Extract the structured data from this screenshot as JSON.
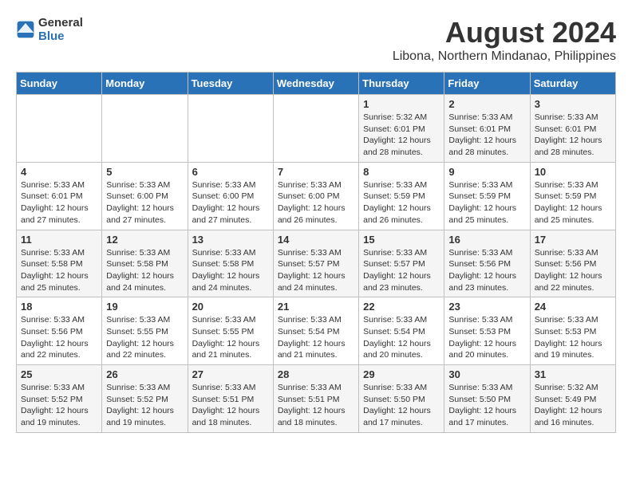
{
  "logo": {
    "line1": "General",
    "line2": "Blue"
  },
  "title": "August 2024",
  "location": "Libona, Northern Mindanao, Philippines",
  "days_of_week": [
    "Sunday",
    "Monday",
    "Tuesday",
    "Wednesday",
    "Thursday",
    "Friday",
    "Saturday"
  ],
  "weeks": [
    [
      {
        "day": "",
        "info": ""
      },
      {
        "day": "",
        "info": ""
      },
      {
        "day": "",
        "info": ""
      },
      {
        "day": "",
        "info": ""
      },
      {
        "day": "1",
        "info": "Sunrise: 5:32 AM\nSunset: 6:01 PM\nDaylight: 12 hours\nand 28 minutes."
      },
      {
        "day": "2",
        "info": "Sunrise: 5:33 AM\nSunset: 6:01 PM\nDaylight: 12 hours\nand 28 minutes."
      },
      {
        "day": "3",
        "info": "Sunrise: 5:33 AM\nSunset: 6:01 PM\nDaylight: 12 hours\nand 28 minutes."
      }
    ],
    [
      {
        "day": "4",
        "info": "Sunrise: 5:33 AM\nSunset: 6:01 PM\nDaylight: 12 hours\nand 27 minutes."
      },
      {
        "day": "5",
        "info": "Sunrise: 5:33 AM\nSunset: 6:00 PM\nDaylight: 12 hours\nand 27 minutes."
      },
      {
        "day": "6",
        "info": "Sunrise: 5:33 AM\nSunset: 6:00 PM\nDaylight: 12 hours\nand 27 minutes."
      },
      {
        "day": "7",
        "info": "Sunrise: 5:33 AM\nSunset: 6:00 PM\nDaylight: 12 hours\nand 26 minutes."
      },
      {
        "day": "8",
        "info": "Sunrise: 5:33 AM\nSunset: 5:59 PM\nDaylight: 12 hours\nand 26 minutes."
      },
      {
        "day": "9",
        "info": "Sunrise: 5:33 AM\nSunset: 5:59 PM\nDaylight: 12 hours\nand 25 minutes."
      },
      {
        "day": "10",
        "info": "Sunrise: 5:33 AM\nSunset: 5:59 PM\nDaylight: 12 hours\nand 25 minutes."
      }
    ],
    [
      {
        "day": "11",
        "info": "Sunrise: 5:33 AM\nSunset: 5:58 PM\nDaylight: 12 hours\nand 25 minutes."
      },
      {
        "day": "12",
        "info": "Sunrise: 5:33 AM\nSunset: 5:58 PM\nDaylight: 12 hours\nand 24 minutes."
      },
      {
        "day": "13",
        "info": "Sunrise: 5:33 AM\nSunset: 5:58 PM\nDaylight: 12 hours\nand 24 minutes."
      },
      {
        "day": "14",
        "info": "Sunrise: 5:33 AM\nSunset: 5:57 PM\nDaylight: 12 hours\nand 24 minutes."
      },
      {
        "day": "15",
        "info": "Sunrise: 5:33 AM\nSunset: 5:57 PM\nDaylight: 12 hours\nand 23 minutes."
      },
      {
        "day": "16",
        "info": "Sunrise: 5:33 AM\nSunset: 5:56 PM\nDaylight: 12 hours\nand 23 minutes."
      },
      {
        "day": "17",
        "info": "Sunrise: 5:33 AM\nSunset: 5:56 PM\nDaylight: 12 hours\nand 22 minutes."
      }
    ],
    [
      {
        "day": "18",
        "info": "Sunrise: 5:33 AM\nSunset: 5:56 PM\nDaylight: 12 hours\nand 22 minutes."
      },
      {
        "day": "19",
        "info": "Sunrise: 5:33 AM\nSunset: 5:55 PM\nDaylight: 12 hours\nand 22 minutes."
      },
      {
        "day": "20",
        "info": "Sunrise: 5:33 AM\nSunset: 5:55 PM\nDaylight: 12 hours\nand 21 minutes."
      },
      {
        "day": "21",
        "info": "Sunrise: 5:33 AM\nSunset: 5:54 PM\nDaylight: 12 hours\nand 21 minutes."
      },
      {
        "day": "22",
        "info": "Sunrise: 5:33 AM\nSunset: 5:54 PM\nDaylight: 12 hours\nand 20 minutes."
      },
      {
        "day": "23",
        "info": "Sunrise: 5:33 AM\nSunset: 5:53 PM\nDaylight: 12 hours\nand 20 minutes."
      },
      {
        "day": "24",
        "info": "Sunrise: 5:33 AM\nSunset: 5:53 PM\nDaylight: 12 hours\nand 19 minutes."
      }
    ],
    [
      {
        "day": "25",
        "info": "Sunrise: 5:33 AM\nSunset: 5:52 PM\nDaylight: 12 hours\nand 19 minutes."
      },
      {
        "day": "26",
        "info": "Sunrise: 5:33 AM\nSunset: 5:52 PM\nDaylight: 12 hours\nand 19 minutes."
      },
      {
        "day": "27",
        "info": "Sunrise: 5:33 AM\nSunset: 5:51 PM\nDaylight: 12 hours\nand 18 minutes."
      },
      {
        "day": "28",
        "info": "Sunrise: 5:33 AM\nSunset: 5:51 PM\nDaylight: 12 hours\nand 18 minutes."
      },
      {
        "day": "29",
        "info": "Sunrise: 5:33 AM\nSunset: 5:50 PM\nDaylight: 12 hours\nand 17 minutes."
      },
      {
        "day": "30",
        "info": "Sunrise: 5:33 AM\nSunset: 5:50 PM\nDaylight: 12 hours\nand 17 minutes."
      },
      {
        "day": "31",
        "info": "Sunrise: 5:32 AM\nSunset: 5:49 PM\nDaylight: 12 hours\nand 16 minutes."
      }
    ]
  ]
}
